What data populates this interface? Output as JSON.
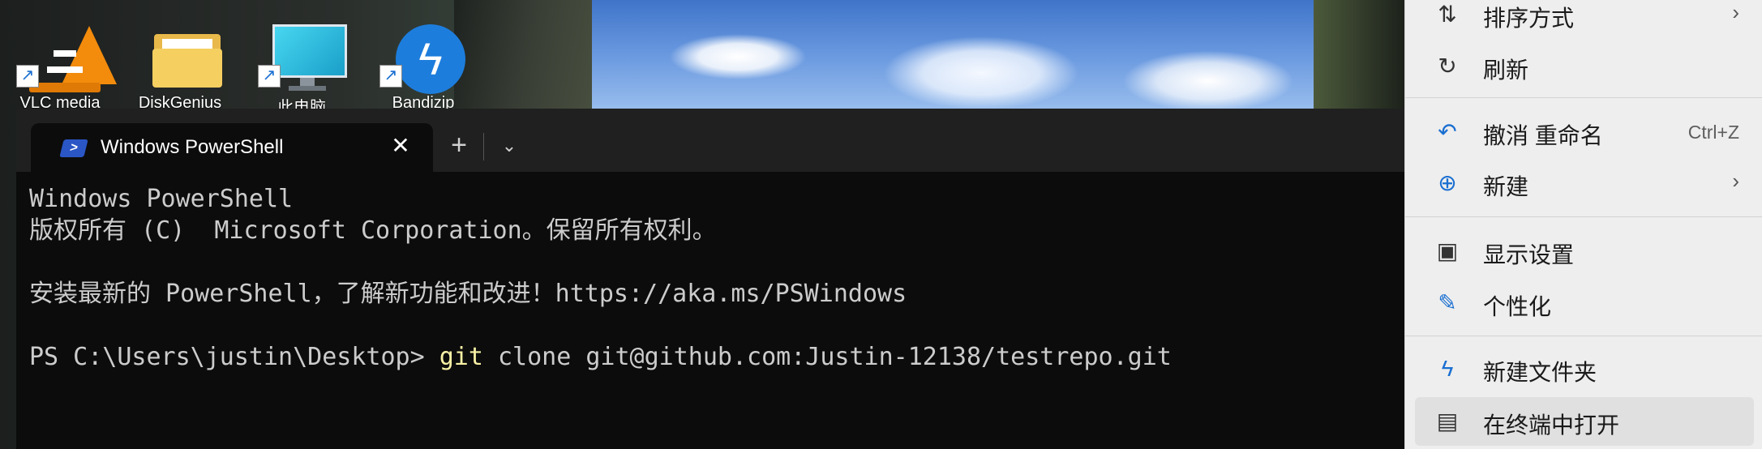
{
  "desktop": {
    "icons": [
      {
        "name": "VLC media player",
        "label": "VLC media"
      },
      {
        "name": "DiskGenius",
        "label": "DiskGenius"
      },
      {
        "name": "This PC",
        "label": "此电脑"
      },
      {
        "name": "Bandizip",
        "label": "Bandizip"
      }
    ]
  },
  "terminal": {
    "tab_title": "Windows PowerShell",
    "close_glyph": "✕",
    "new_tab_glyph": "+",
    "dropdown_glyph": "⌄",
    "lines": [
      "Windows PowerShell",
      "版权所有 (C)  Microsoft Corporation。保留所有权利。",
      "",
      "安装最新的 PowerShell，了解新功能和改进！https://aka.ms/PSWindows",
      ""
    ],
    "prompt": "PS C:\\Users\\justin\\Desktop> ",
    "command": "git",
    "command_args": " clone git@github.com:Justin-12138/testrepo.git"
  },
  "context_menu": {
    "items": [
      {
        "icon": "sort-icon",
        "label": "排序方式",
        "shortcut": "",
        "submenu": true
      },
      {
        "icon": "refresh-icon",
        "label": "刷新",
        "shortcut": "",
        "submenu": false
      },
      {
        "icon": "undo-icon",
        "label": "撤消 重命名",
        "shortcut": "Ctrl+Z",
        "submenu": false
      },
      {
        "icon": "new-icon",
        "label": "新建",
        "shortcut": "",
        "submenu": true
      },
      {
        "icon": "display-settings-icon",
        "label": "显示设置",
        "shortcut": "",
        "submenu": false
      },
      {
        "icon": "personalize-icon",
        "label": "个性化",
        "shortcut": "",
        "submenu": false
      },
      {
        "icon": "new-folder-icon",
        "label": "新建文件夹",
        "shortcut": "",
        "submenu": false
      },
      {
        "icon": "terminal-icon",
        "label": "在终端中打开",
        "shortcut": "",
        "submenu": false
      }
    ],
    "submenu_glyph": "›"
  },
  "colors": {
    "terminal_bg": "#0c0c0c",
    "tabbar_bg": "#202020",
    "console_text": "#cccccc",
    "command_text": "#f9f1a5",
    "menu_bg": "#eeeeee",
    "accent": "#1a6fd1"
  }
}
